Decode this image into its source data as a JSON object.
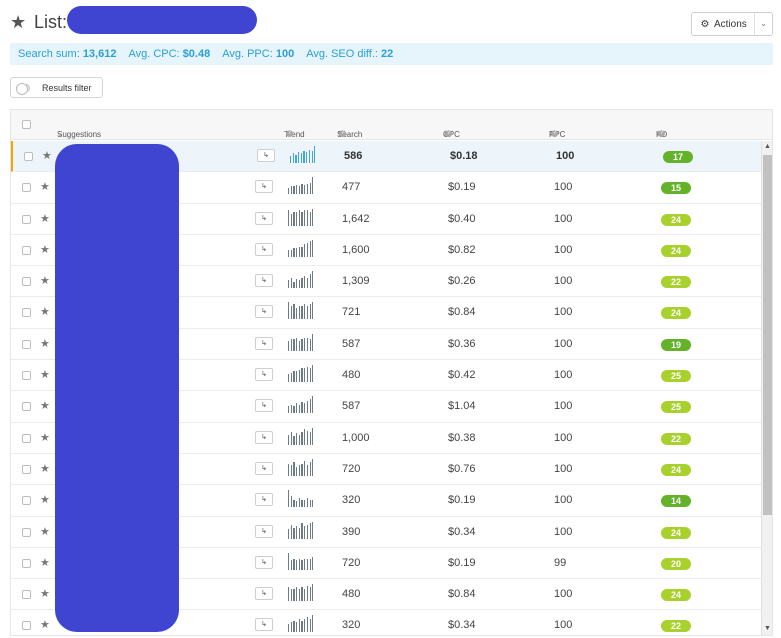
{
  "header": {
    "title": "List:",
    "actions_label": "Actions"
  },
  "summary": {
    "search_sum_label": "Search sum:",
    "search_sum_value": "13,612",
    "avg_cpc_label": "Avg. CPC:",
    "avg_cpc_value": "$0.48",
    "avg_ppc_label": "Avg. PPC:",
    "avg_ppc_value": "100",
    "avg_seo_label": "Avg. SEO diff.:",
    "avg_seo_value": "22"
  },
  "filter": {
    "label": "Results filter"
  },
  "table": {
    "columns": {
      "suggestions": "Suggestions",
      "trend": "Trend",
      "search": "Search",
      "cpc": "CPC",
      "ppc": "PPC",
      "kd": "KD"
    },
    "rows": [
      {
        "search": "586",
        "cpc": "$0.18",
        "ppc": "100",
        "kd": "17",
        "trend": [
          6,
          8,
          7,
          9,
          8,
          10,
          9,
          11,
          10,
          14
        ]
      },
      {
        "search": "477",
        "cpc": "$0.19",
        "ppc": "100",
        "kd": "15",
        "trend": [
          5,
          6,
          6,
          7,
          6,
          8,
          7,
          8,
          9,
          13
        ]
      },
      {
        "search": "1,642",
        "cpc": "$0.40",
        "ppc": "100",
        "kd": "24",
        "trend": [
          9,
          7,
          8,
          8,
          9,
          8,
          9,
          9,
          8,
          10
        ]
      },
      {
        "search": "1,600",
        "cpc": "$0.82",
        "ppc": "100",
        "kd": "24",
        "trend": [
          5,
          5,
          6,
          6,
          7,
          7,
          9,
          10,
          11,
          12
        ]
      },
      {
        "search": "1,309",
        "cpc": "$0.26",
        "ppc": "100",
        "kd": "22",
        "trend": [
          6,
          8,
          5,
          7,
          6,
          8,
          9,
          8,
          11,
          13
        ]
      },
      {
        "search": "721",
        "cpc": "$0.84",
        "ppc": "100",
        "kd": "24",
        "trend": [
          10,
          8,
          9,
          7,
          8,
          8,
          9,
          8,
          9,
          10
        ]
      },
      {
        "search": "587",
        "cpc": "$0.36",
        "ppc": "100",
        "kd": "19",
        "trend": [
          7,
          8,
          8,
          9,
          7,
          8,
          9,
          9,
          8,
          12
        ]
      },
      {
        "search": "480",
        "cpc": "$0.42",
        "ppc": "100",
        "kd": "25",
        "trend": [
          5,
          6,
          7,
          7,
          8,
          9,
          9,
          10,
          9,
          11
        ]
      },
      {
        "search": "587",
        "cpc": "$1.04",
        "ppc": "100",
        "kd": "25",
        "trend": [
          5,
          6,
          5,
          7,
          6,
          8,
          7,
          9,
          10,
          12
        ]
      },
      {
        "search": "1,000",
        "cpc": "$0.38",
        "ppc": "100",
        "kd": "22",
        "trend": [
          7,
          9,
          6,
          8,
          7,
          9,
          11,
          10,
          9,
          12
        ]
      },
      {
        "search": "720",
        "cpc": "$0.76",
        "ppc": "100",
        "kd": "24",
        "trend": [
          8,
          7,
          9,
          6,
          7,
          8,
          10,
          7,
          9,
          11
        ]
      },
      {
        "search": "320",
        "cpc": "$0.19",
        "ppc": "100",
        "kd": "14",
        "trend": [
          11,
          7,
          5,
          4,
          6,
          5,
          5,
          6,
          5,
          5
        ]
      },
      {
        "search": "390",
        "cpc": "$0.34",
        "ppc": "100",
        "kd": "24",
        "trend": [
          6,
          9,
          7,
          8,
          7,
          10,
          8,
          9,
          10,
          11
        ]
      },
      {
        "search": "720",
        "cpc": "$0.19",
        "ppc": "99",
        "kd": "20",
        "trend": [
          9,
          5,
          6,
          5,
          6,
          5,
          6,
          6,
          6,
          7
        ]
      },
      {
        "search": "480",
        "cpc": "$0.84",
        "ppc": "100",
        "kd": "24",
        "trend": [
          9,
          8,
          8,
          9,
          8,
          9,
          8,
          10,
          9,
          11
        ]
      },
      {
        "search": "320",
        "cpc": "$0.34",
        "ppc": "100",
        "kd": "22",
        "trend": [
          5,
          6,
          7,
          6,
          8,
          7,
          8,
          9,
          8,
          10
        ]
      }
    ]
  },
  "colors": {
    "accent": "#2a9fd8",
    "kd_dark": "#63b22a",
    "kd_light": "#a9d12e",
    "redaction": "#3f45d1",
    "active_border": "#f0a500"
  },
  "icons": {
    "title": "star-icon",
    "actions": "gear-icon",
    "row_star": "star-icon",
    "row_open": "open-arrow-icon",
    "help": "question-icon"
  }
}
